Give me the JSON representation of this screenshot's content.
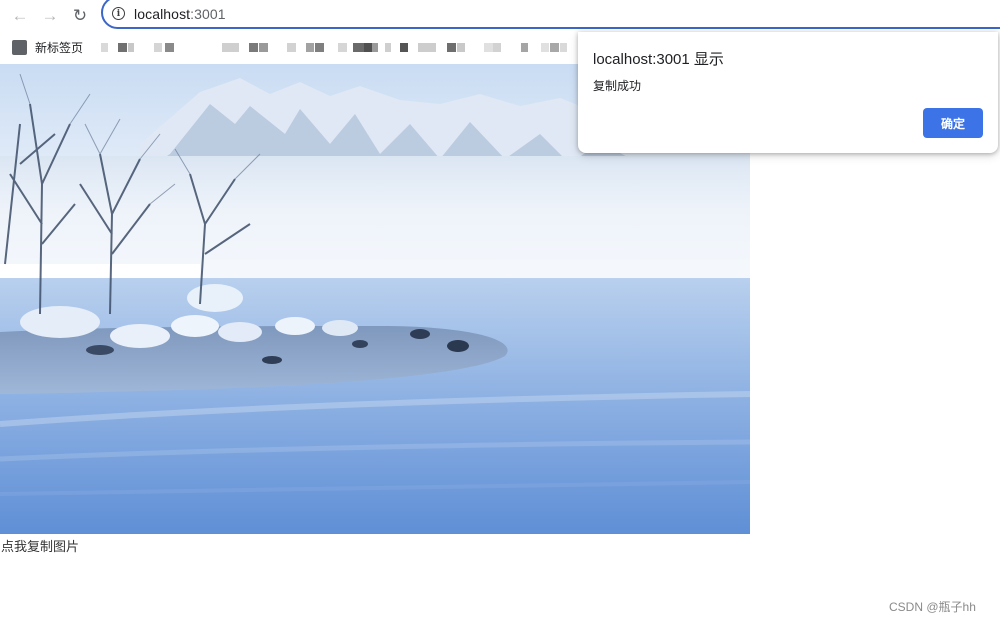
{
  "browser": {
    "url_host": "localhost",
    "url_port": ":3001",
    "bookmark_label": "新标签页",
    "info_glyph": "i"
  },
  "icons": {
    "back": "back-arrow-icon",
    "forward": "forward-arrow-icon",
    "reload": "reload-icon",
    "info": "info-icon",
    "bookmark": "bookmark-favicon"
  },
  "page": {
    "copy_label": "点我复制图片",
    "watermark": "CSDN @瓶子hh"
  },
  "dialog": {
    "title": "localhost:3001 显示",
    "message": "复制成功",
    "ok_label": "确定"
  },
  "colors": {
    "accent_blue": "#3c74e8",
    "omnibox_focus": "#3c66c7"
  }
}
